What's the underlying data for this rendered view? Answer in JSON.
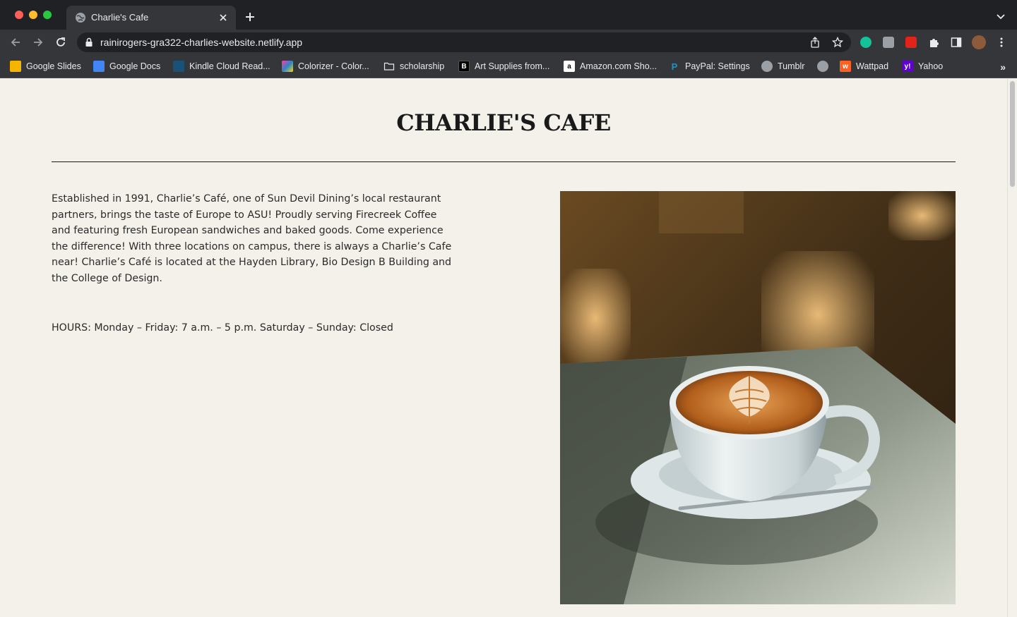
{
  "browser": {
    "tab": {
      "title": "Charlie's Cafe"
    },
    "address_bar": {
      "url": "rainirogers-gra322-charlies-website.netlify.app"
    },
    "bookmarks": [
      {
        "label": "Google Slides",
        "icon": "google-slides-icon",
        "color": "#f4b400"
      },
      {
        "label": "Google Docs",
        "icon": "google-docs-icon",
        "color": "#4285f4"
      },
      {
        "label": "Kindle Cloud Read...",
        "icon": "kindle-icon",
        "color": "#1a5276"
      },
      {
        "label": "Colorizer - Color...",
        "icon": "colorizer-icon",
        "color": "#ff3cac"
      },
      {
        "label": "scholarship",
        "icon": "folder-icon",
        "color": "#9aa0a6"
      },
      {
        "label": "Art Supplies from...",
        "icon": "blick-icon",
        "color": "#000000"
      },
      {
        "label": "Amazon.com Sho...",
        "icon": "amazon-icon",
        "color": "#ffffff"
      },
      {
        "label": "PayPal: Settings",
        "icon": "paypal-icon",
        "color": "#003087"
      },
      {
        "label": "Tumblr",
        "icon": "globe-icon",
        "color": "#9aa0a6"
      },
      {
        "label": "",
        "icon": "globe-icon",
        "color": "#9aa0a6"
      },
      {
        "label": "Wattpad",
        "icon": "wattpad-icon",
        "color": "#ff6122"
      },
      {
        "label": "Yahoo",
        "icon": "yahoo-icon",
        "color": "#6001d2"
      }
    ],
    "more_bookmarks": "»"
  },
  "page": {
    "title": "CHARLIE'S CAFE",
    "intro": "Established in 1991, Charlie’s Café, one of Sun Devil Dining’s local restaurant partners, brings the taste of Europe to ASU! Proudly serving Firecreek Coffee and featuring fresh European sandwiches and baked goods. Come experience the difference! With three locations on campus, there is always a Charlie’s Cafe near! Charlie’s Café is located at the Hayden Library, Bio Design B Building and the College of Design.",
    "hours": "HOURS: Monday – Friday: 7 a.m. – 5 p.m. Saturday – Sunday: Closed",
    "background_color": "#f4f1ea"
  }
}
